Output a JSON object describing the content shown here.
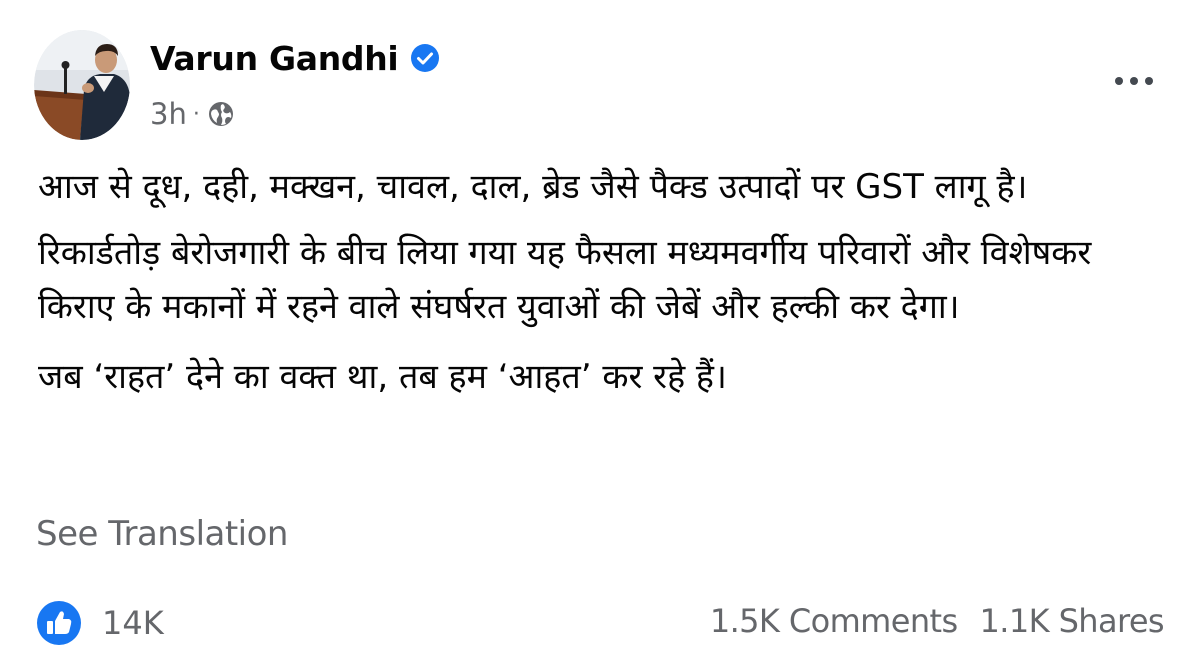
{
  "post": {
    "author": "Varun Gandhi",
    "time": "3h",
    "separator": "·",
    "icons": {
      "verified": "verified-badge-icon",
      "audience": "globe-icon",
      "more": "more-options-icon",
      "reaction": "like-icon"
    },
    "colors": {
      "verified": "#1877f2",
      "like": "#1877f2",
      "secondary_text": "#65676b"
    },
    "paragraphs": [
      "आज से दूध, दही, मक्खन, चावल, दाल, ब्रेड जैसे पैक्ड उत्पादों पर GST लागू है।",
      "रिकार्डतोड़ बेरोजगारी के बीच लिया गया यह फैसला मध्यमवर्गीय परिवारों और विशेषकर किराए के मकानों में रहने वाले संघर्षरत युवाओं की जेबें और हल्की कर देगा।",
      "जब ‘राहत’ देने का वक्त था, तब हम ‘आहत’ कर रहे हैं।"
    ],
    "see_translation": "See Translation",
    "reactions_count": "14K",
    "comments": "1.5K Comments",
    "shares": "1.1K Shares"
  }
}
